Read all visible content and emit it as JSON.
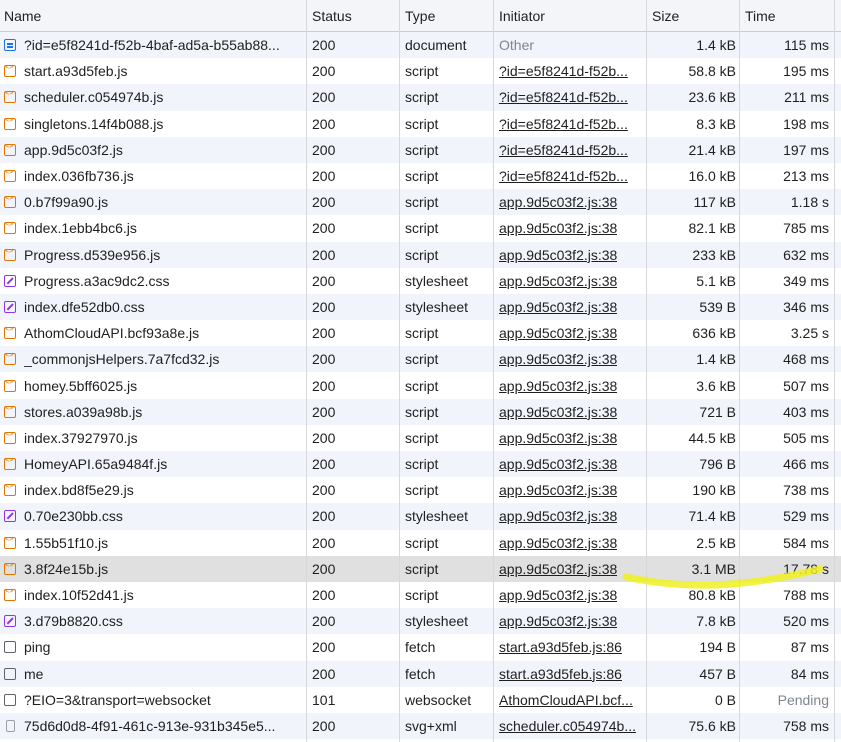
{
  "columns": {
    "name": "Name",
    "status": "Status",
    "type": "Type",
    "initiator": "Initiator",
    "size": "Size",
    "time": "Time"
  },
  "selected_row": 20,
  "annotation_color": "#f0f020",
  "icon_colors": {
    "document": "#1a73e8",
    "script": "#e37400",
    "stylesheet": "#9334e6",
    "fetch": "#5f6368",
    "websocket": "#5f6368",
    "svg+xml": "#9aa0a6"
  },
  "rows": [
    {
      "name": "?id=e5f8241d-f52b-4baf-ad5a-b55ab88...",
      "status": "200",
      "type": "document",
      "initiator": "Other",
      "size": "1.4 kB",
      "time": "115 ms",
      "icon": "document-icon"
    },
    {
      "name": "start.a93d5feb.js",
      "status": "200",
      "type": "script",
      "initiator": "?id=e5f8241d-f52b...",
      "size": "58.8 kB",
      "time": "195 ms",
      "icon": "script-icon"
    },
    {
      "name": "scheduler.c054974b.js",
      "status": "200",
      "type": "script",
      "initiator": "?id=e5f8241d-f52b...",
      "size": "23.6 kB",
      "time": "211 ms",
      "icon": "script-icon"
    },
    {
      "name": "singletons.14f4b088.js",
      "status": "200",
      "type": "script",
      "initiator": "?id=e5f8241d-f52b...",
      "size": "8.3 kB",
      "time": "198 ms",
      "icon": "script-icon"
    },
    {
      "name": "app.9d5c03f2.js",
      "status": "200",
      "type": "script",
      "initiator": "?id=e5f8241d-f52b...",
      "size": "21.4 kB",
      "time": "197 ms",
      "icon": "script-icon"
    },
    {
      "name": "index.036fb736.js",
      "status": "200",
      "type": "script",
      "initiator": "?id=e5f8241d-f52b...",
      "size": "16.0 kB",
      "time": "213 ms",
      "icon": "script-icon"
    },
    {
      "name": "0.b7f99a90.js",
      "status": "200",
      "type": "script",
      "initiator": "app.9d5c03f2.js:38",
      "size": "117 kB",
      "time": "1.18 s",
      "icon": "script-icon"
    },
    {
      "name": "index.1ebb4bc6.js",
      "status": "200",
      "type": "script",
      "initiator": "app.9d5c03f2.js:38",
      "size": "82.1 kB",
      "time": "785 ms",
      "icon": "script-icon"
    },
    {
      "name": "Progress.d539e956.js",
      "status": "200",
      "type": "script",
      "initiator": "app.9d5c03f2.js:38",
      "size": "233 kB",
      "time": "632 ms",
      "icon": "script-icon"
    },
    {
      "name": "Progress.a3ac9dc2.css",
      "status": "200",
      "type": "stylesheet",
      "initiator": "app.9d5c03f2.js:38",
      "size": "5.1 kB",
      "time": "349 ms",
      "icon": "stylesheet-icon"
    },
    {
      "name": "index.dfe52db0.css",
      "status": "200",
      "type": "stylesheet",
      "initiator": "app.9d5c03f2.js:38",
      "size": "539 B",
      "time": "346 ms",
      "icon": "stylesheet-icon"
    },
    {
      "name": "AthomCloudAPI.bcf93a8e.js",
      "status": "200",
      "type": "script",
      "initiator": "app.9d5c03f2.js:38",
      "size": "636 kB",
      "time": "3.25 s",
      "icon": "script-icon"
    },
    {
      "name": "_commonjsHelpers.7a7fcd32.js",
      "status": "200",
      "type": "script",
      "initiator": "app.9d5c03f2.js:38",
      "size": "1.4 kB",
      "time": "468 ms",
      "icon": "script-icon"
    },
    {
      "name": "homey.5bff6025.js",
      "status": "200",
      "type": "script",
      "initiator": "app.9d5c03f2.js:38",
      "size": "3.6 kB",
      "time": "507 ms",
      "icon": "script-icon"
    },
    {
      "name": "stores.a039a98b.js",
      "status": "200",
      "type": "script",
      "initiator": "app.9d5c03f2.js:38",
      "size": "721 B",
      "time": "403 ms",
      "icon": "script-icon"
    },
    {
      "name": "index.37927970.js",
      "status": "200",
      "type": "script",
      "initiator": "app.9d5c03f2.js:38",
      "size": "44.5 kB",
      "time": "505 ms",
      "icon": "script-icon"
    },
    {
      "name": "HomeyAPI.65a9484f.js",
      "status": "200",
      "type": "script",
      "initiator": "app.9d5c03f2.js:38",
      "size": "796 B",
      "time": "466 ms",
      "icon": "script-icon"
    },
    {
      "name": "index.bd8f5e29.js",
      "status": "200",
      "type": "script",
      "initiator": "app.9d5c03f2.js:38",
      "size": "190 kB",
      "time": "738 ms",
      "icon": "script-icon"
    },
    {
      "name": "0.70e230bb.css",
      "status": "200",
      "type": "stylesheet",
      "initiator": "app.9d5c03f2.js:38",
      "size": "71.4 kB",
      "time": "529 ms",
      "icon": "stylesheet-icon"
    },
    {
      "name": "1.55b51f10.js",
      "status": "200",
      "type": "script",
      "initiator": "app.9d5c03f2.js:38",
      "size": "2.5 kB",
      "time": "584 ms",
      "icon": "script-icon"
    },
    {
      "name": "3.8f24e15b.js",
      "status": "200",
      "type": "script",
      "initiator": "app.9d5c03f2.js:38",
      "size": "3.1 MB",
      "time": "17.78 s",
      "icon": "script-icon"
    },
    {
      "name": "index.10f52d41.js",
      "status": "200",
      "type": "script",
      "initiator": "app.9d5c03f2.js:38",
      "size": "80.8 kB",
      "time": "788 ms",
      "icon": "script-icon"
    },
    {
      "name": "3.d79b8820.css",
      "status": "200",
      "type": "stylesheet",
      "initiator": "app.9d5c03f2.js:38",
      "size": "7.8 kB",
      "time": "520 ms",
      "icon": "stylesheet-icon"
    },
    {
      "name": "ping",
      "status": "200",
      "type": "fetch",
      "initiator": "start.a93d5feb.js:86",
      "size": "194 B",
      "time": "87 ms",
      "icon": "fetch-icon"
    },
    {
      "name": "me",
      "status": "200",
      "type": "fetch",
      "initiator": "start.a93d5feb.js:86",
      "size": "457 B",
      "time": "84 ms",
      "icon": "fetch-icon"
    },
    {
      "name": "?EIO=3&transport=websocket",
      "status": "101",
      "type": "websocket",
      "initiator": "AthomCloudAPI.bcf...",
      "size": "0 B",
      "time": "Pending",
      "icon": "websocket-icon"
    },
    {
      "name": "75d6d0d8-4f91-461c-913e-931b345e5...",
      "status": "200",
      "type": "svg+xml",
      "initiator": "scheduler.c054974b...",
      "size": "75.6 kB",
      "time": "758 ms",
      "icon": "svg-icon"
    }
  ]
}
